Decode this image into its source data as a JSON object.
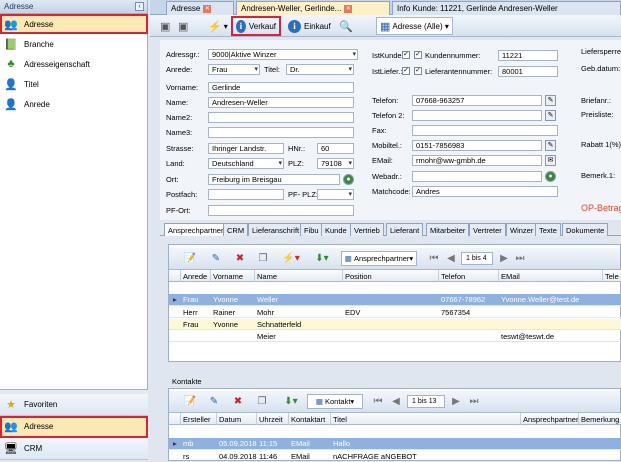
{
  "leftnav": {
    "title": "Adresse",
    "items": [
      {
        "label": "Adresse",
        "icon": "address-book-icon"
      },
      {
        "label": "Branche",
        "icon": "branch-icon"
      },
      {
        "label": "Adresseigenschaft",
        "icon": "tree-icon"
      },
      {
        "label": "Titel",
        "icon": "person-icon"
      },
      {
        "label": "Anrede",
        "icon": "person-icon"
      }
    ],
    "bottom": [
      {
        "label": "Favoriten",
        "icon": "star-icon"
      },
      {
        "label": "Adresse",
        "icon": "address-book-icon"
      },
      {
        "label": "CRM",
        "icon": "crm-icon"
      }
    ]
  },
  "tabs": [
    {
      "label": "Adresse"
    },
    {
      "label": "Andresen-Weller, Gerlinde..."
    },
    {
      "label": "Info Kunde: 11221, Gerlinde Andresen-Weller"
    }
  ],
  "toolbar": {
    "verkauf": "Verkauf",
    "einkauf": "Einkauf",
    "filter": "Adresse (Alle)"
  },
  "form": {
    "adressgr_label": "Adressgr.:",
    "adressgr": "9000|Aktive Winzer",
    "anrede_label": "Anrede:",
    "anrede": "Frau",
    "titel_label": "Titel:",
    "titel": "Dr.",
    "vorname_label": "Vorname:",
    "vorname": "Gerlinde",
    "name_label": "Name:",
    "name": "Andresen-Weller",
    "name2_label": "Name2:",
    "name3_label": "Name3:",
    "strasse_label": "Strasse:",
    "strasse": "Ihringer Landstr.",
    "hnr_label": "HNr.:",
    "hnr": "60",
    "land_label": "Land:",
    "land": "Deutschland",
    "plz_label": "PLZ:",
    "plz": "79108",
    "ort_label": "Ort:",
    "ort": "Freiburg im Breisgau",
    "postfach_label": "Postfach:",
    "pfplz_label": "PF- PLZ:",
    "pfort_label": "PF-Ort:",
    "istkunde_label": "IstKunde:",
    "kundennummer_label": "Kundennummer:",
    "kundennummer": "11221",
    "istlief_label": "IstLiefer.:",
    "lieferantennummer_label": "Lieferantennummer:",
    "lieferantennummer": "80001",
    "telefon_label": "Telefon:",
    "telefon": "07668-963257",
    "telefon2_label": "Telefon 2:",
    "fax_label": "Fax:",
    "mobil_label": "Mobiltel.:",
    "mobil": "0151-7856983",
    "email_label": "EMail:",
    "email": "rmohr@ww-gmbh.de",
    "webadr_label": "Webadr.:",
    "matchcode_label": "Matchcode:",
    "matchcode": "Andres",
    "liefersperre_label": "Liefersperre:",
    "gebdatum_label": "Geb.datum:",
    "briefanr_label": "Briefanr.:",
    "preisliste_label": "Preisliste:",
    "rabatt_label": "Rabatt 1(%):",
    "bemerk_label": "Bemerk.1:",
    "op_label": "OP-Betrag"
  },
  "subtabs": [
    "Ansprechpartner",
    "CRM",
    "Lieferanschrift",
    "Fibu",
    "Kunde",
    "Vertrieb",
    "Lieferant",
    "Mitarbeiter",
    "Vertreter",
    "Winzer",
    "Texte",
    "Dokumente"
  ],
  "contacts_grid": {
    "filter": "Ansprechpartner",
    "pager": "1 bis 4",
    "columns": [
      "Anrede",
      "Vorname",
      "Name",
      "Position",
      "Telefon",
      "EMail",
      "Tele"
    ],
    "rows": [
      [
        "Frau",
        "Yvonne",
        "Weller",
        "",
        "07667-78962",
        "Yvonne.Weller@test.de",
        ""
      ],
      [
        "Herr",
        "Rainer",
        "Mohr",
        "EDV",
        "7567354",
        "",
        ""
      ],
      [
        "Frau",
        "Yvonne",
        "Schnatterfeld",
        "",
        "",
        "",
        ""
      ],
      [
        "",
        "",
        "Meier",
        "",
        "",
        "teswt@teswt.de",
        ""
      ]
    ]
  },
  "kontakte": {
    "title": "Kontakte",
    "filter": "Kontakt",
    "pager": "1 bis 13",
    "columns": [
      "Ersteller",
      "Datum",
      "Uhrzeit",
      "Kontaktart",
      "Titel",
      "Ansprechpartner",
      "Bemerkung"
    ],
    "rows": [
      [
        "mb",
        "05.09.2018",
        "11:15",
        "EMail",
        "Hallo",
        "",
        ""
      ],
      [
        "rs",
        "04.09.2018",
        "11:46",
        "EMail",
        "nACHFRAGE aNGEBOT",
        "",
        ""
      ]
    ]
  }
}
